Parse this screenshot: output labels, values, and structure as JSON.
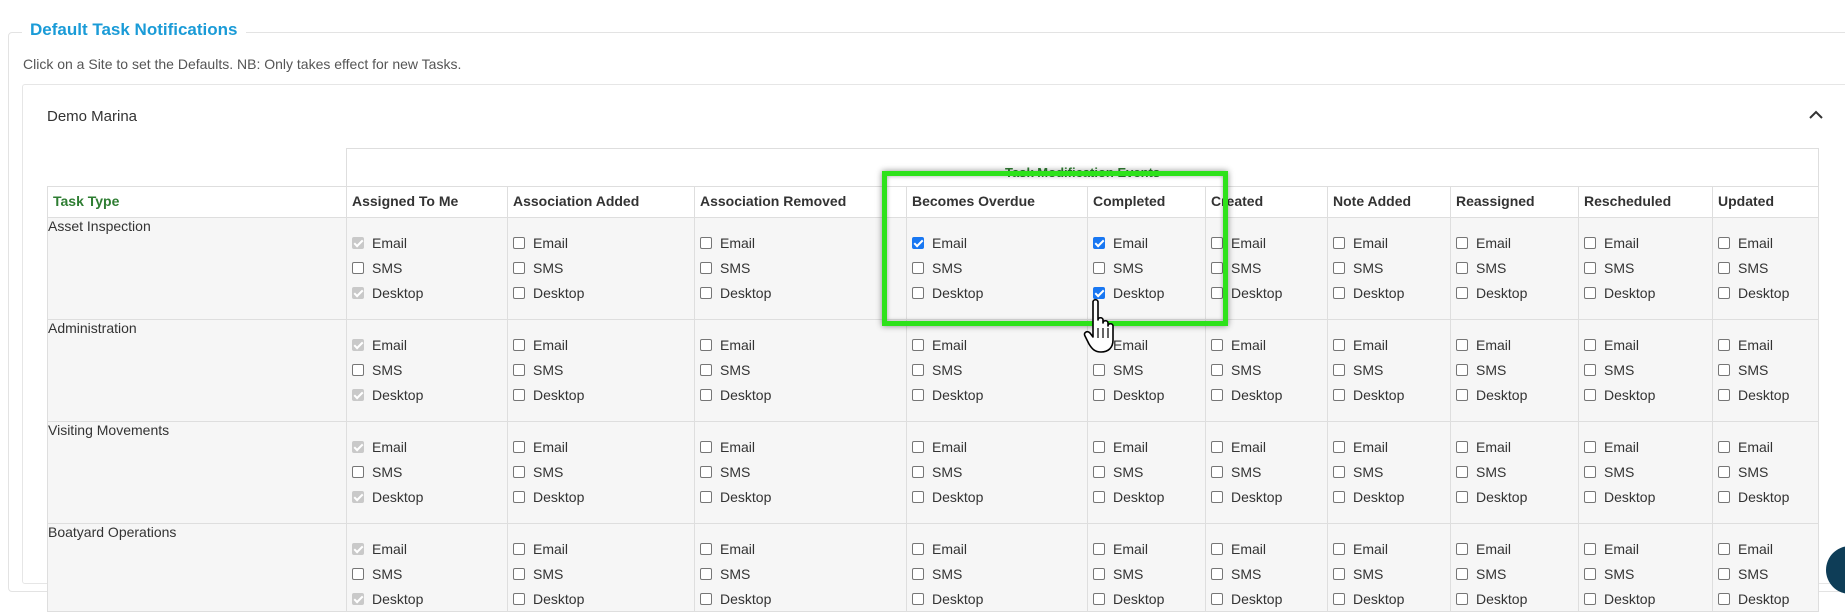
{
  "section": {
    "legend": "Default Task Notifications",
    "hint": "Click on a Site to set the Defaults. NB: Only takes effect for new Tasks."
  },
  "site": {
    "name": "Demo Marina"
  },
  "table": {
    "group_header": "Task Modification Events",
    "task_type_header": "Task Type",
    "events": [
      "Assigned To Me",
      "Association Added",
      "Association Removed",
      "Becomes Overdue",
      "Completed",
      "Created",
      "Note Added",
      "Reassigned",
      "Rescheduled",
      "Updated"
    ],
    "option_labels": [
      "Email",
      "SMS",
      "Desktop"
    ],
    "rows": [
      {
        "task_type": "Asset Inspection",
        "checked": {
          "Assigned To Me": [
            true,
            false,
            true
          ],
          "Becomes Overdue": [
            true,
            false,
            false
          ],
          "Completed": [
            true,
            false,
            true
          ]
        }
      },
      {
        "task_type": "Administration",
        "checked": {
          "Assigned To Me": [
            true,
            false,
            true
          ]
        }
      },
      {
        "task_type": "Visiting Movements",
        "checked": {
          "Assigned To Me": [
            true,
            false,
            true
          ]
        }
      },
      {
        "task_type": "Boatyard Operations",
        "checked": {
          "Assigned To Me": [
            true,
            false,
            true
          ]
        }
      }
    ],
    "disabled_event": "Assigned To Me",
    "disabled_options": [
      "Email",
      "Desktop"
    ]
  },
  "colors": {
    "accent": "#1a9bd7",
    "header_green": "#2e7d32",
    "highlight": "#2ee21b",
    "checkbox_checked": "#1877f2"
  }
}
